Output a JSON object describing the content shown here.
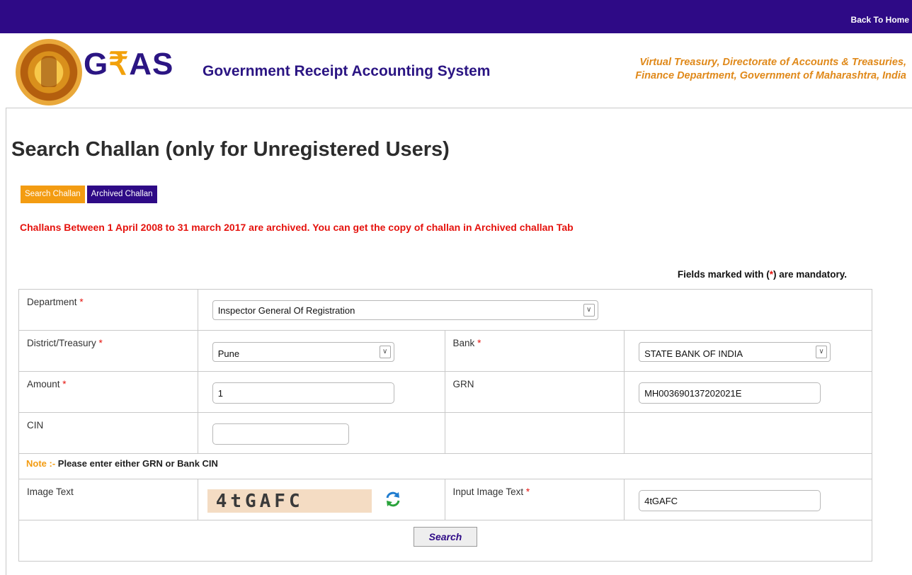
{
  "topbar": {
    "back_home": "Back To Home"
  },
  "header": {
    "logo_g": "G",
    "logo_rupee": "₹",
    "logo_as": "AS",
    "logo_subtitle": "Government Receipt Accounting System",
    "org_line1": "Virtual Treasury, Directorate of Accounts & Treasuries,",
    "org_line2": "Finance Department, Government of Maharashtra, India"
  },
  "page": {
    "title": "Search Challan (only for Unregistered Users)",
    "tabs": [
      {
        "label": "Search Challan",
        "active": true
      },
      {
        "label": "Archived Challan",
        "active": false
      }
    ],
    "notice": "Challans Between 1 April 2008 to 31 march 2017 are archived. You can get the copy of challan in Archived challan Tab",
    "mandatory_prefix": "Fields marked with (",
    "mandatory_star": "*",
    "mandatory_suffix": ") are mandatory."
  },
  "form": {
    "required_mark": "*",
    "department": {
      "label": "Department",
      "value": "Inspector General Of Registration"
    },
    "district": {
      "label": "District/Treasury",
      "value": "Pune"
    },
    "bank": {
      "label": "Bank",
      "value": "STATE BANK OF INDIA"
    },
    "amount": {
      "label": "Amount",
      "value": "1"
    },
    "grn": {
      "label": "GRN",
      "value": "MH003690137202021E"
    },
    "cin": {
      "label": "CIN",
      "value": ""
    },
    "note_label": "Note :-",
    "note_text": "Please enter either GRN or Bank CIN",
    "image_text": {
      "label": "Image Text",
      "captcha": "4tGAFC"
    },
    "input_image_text": {
      "label": "Input Image Text",
      "value": "4tGAFC"
    },
    "search_button": "Search"
  },
  "colors": {
    "topbar": "#2e0a86",
    "accent": "#f39c12",
    "alert": "#e5130e"
  }
}
